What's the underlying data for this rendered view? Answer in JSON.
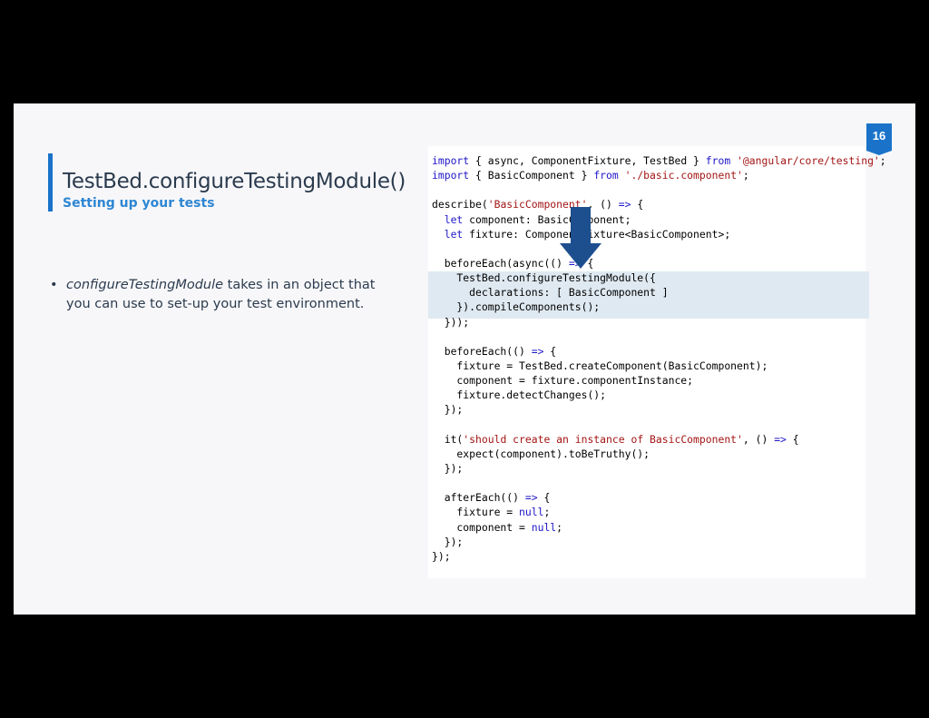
{
  "slide": {
    "title": "TestBed.configureTestingModule()",
    "subtitle": "Setting up your tests",
    "page_number": "16",
    "bullet": {
      "emphasis": "configureTestingModule",
      "text": " takes in an object that you can use to set-up your test environment."
    }
  },
  "colors": {
    "accent": "#1a73c9",
    "highlight": "#dfe9f1",
    "keyword": "#1f16c7",
    "string": "#a31515",
    "arrow": "#1d4f8f"
  },
  "icons": {
    "arrow": "arrow-down-icon"
  },
  "code": {
    "highlighted_lines": [
      8,
      9,
      10
    ],
    "lines": [
      [
        [
          "kw",
          "import"
        ],
        [
          "t",
          " { async, ComponentFixture, TestBed } "
        ],
        [
          "kw",
          "from"
        ],
        [
          "t",
          " "
        ],
        [
          "str",
          "'@angular/core/testing'"
        ],
        [
          "t",
          ";"
        ]
      ],
      [
        [
          "kw",
          "import"
        ],
        [
          "t",
          " { BasicComponent } "
        ],
        [
          "kw",
          "from"
        ],
        [
          "t",
          " "
        ],
        [
          "str",
          "'./basic.component'"
        ],
        [
          "t",
          ";"
        ]
      ],
      [],
      [
        [
          "t",
          "describe("
        ],
        [
          "str",
          "'BasicComponent'"
        ],
        [
          "t",
          ", () "
        ],
        [
          "kw",
          "=>"
        ],
        [
          "t",
          " {"
        ]
      ],
      [
        [
          "t",
          "  "
        ],
        [
          "kw",
          "let"
        ],
        [
          "t",
          " component: BasicComponent;"
        ]
      ],
      [
        [
          "t",
          "  "
        ],
        [
          "kw",
          "let"
        ],
        [
          "t",
          " fixture: ComponentFixture<BasicComponent>;"
        ]
      ],
      [],
      [
        [
          "t",
          "  beforeEach(async(() "
        ],
        [
          "kw",
          "=>"
        ],
        [
          "t",
          " {"
        ]
      ],
      [
        [
          "t",
          "    TestBed.configureTestingModule({"
        ]
      ],
      [
        [
          "t",
          "      declarations: [ BasicComponent ]"
        ]
      ],
      [
        [
          "t",
          "    }).compileComponents();"
        ]
      ],
      [
        [
          "t",
          "  }));"
        ]
      ],
      [],
      [
        [
          "t",
          "  beforeEach(() "
        ],
        [
          "kw",
          "=>"
        ],
        [
          "t",
          " {"
        ]
      ],
      [
        [
          "t",
          "    fixture = TestBed.createComponent(BasicComponent);"
        ]
      ],
      [
        [
          "t",
          "    component = fixture.componentInstance;"
        ]
      ],
      [
        [
          "t",
          "    fixture.detectChanges();"
        ]
      ],
      [
        [
          "t",
          "  });"
        ]
      ],
      [],
      [
        [
          "t",
          "  it("
        ],
        [
          "str",
          "'should create an instance of BasicComponent'"
        ],
        [
          "t",
          ", () "
        ],
        [
          "kw",
          "=>"
        ],
        [
          "t",
          " {"
        ]
      ],
      [
        [
          "t",
          "    expect(component).toBeTruthy();"
        ]
      ],
      [
        [
          "t",
          "  });"
        ]
      ],
      [],
      [
        [
          "t",
          "  afterEach(() "
        ],
        [
          "kw",
          "=>"
        ],
        [
          "t",
          " {"
        ]
      ],
      [
        [
          "t",
          "    fixture = "
        ],
        [
          "kw",
          "null"
        ],
        [
          "t",
          ";"
        ]
      ],
      [
        [
          "t",
          "    component = "
        ],
        [
          "kw",
          "null"
        ],
        [
          "t",
          ";"
        ]
      ],
      [
        [
          "t",
          "  });"
        ]
      ],
      [
        [
          "t",
          "});"
        ]
      ]
    ]
  }
}
